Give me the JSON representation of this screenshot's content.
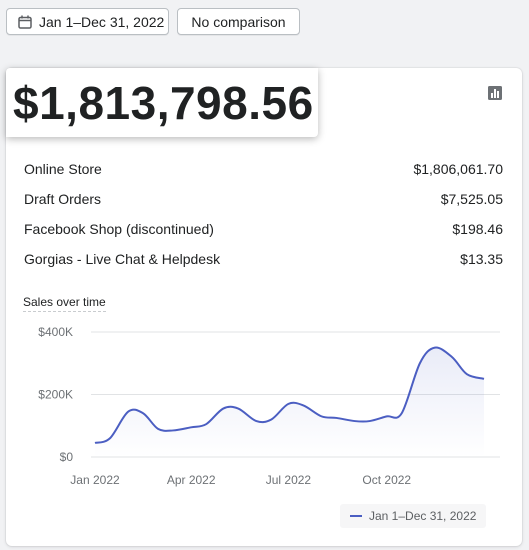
{
  "toolbar": {
    "date_range_label": "Jan 1–Dec 31, 2022",
    "comparison_label": "No comparison"
  },
  "summary": {
    "total_sales": "$1,813,798.56",
    "channels": [
      {
        "name": "Online Store",
        "amount": "$1,806,061.70"
      },
      {
        "name": "Draft Orders",
        "amount": "$7,525.05"
      },
      {
        "name": "Facebook Shop (discontinued)",
        "amount": "$198.46"
      },
      {
        "name": "Gorgias - Live Chat & Helpdesk",
        "amount": "$13.35"
      }
    ]
  },
  "chart_title": "Sales over time",
  "icons": {
    "date": "calendar-icon",
    "chart_toggle": "bar-chart-icon"
  },
  "colors": {
    "series": "#4b5ec2",
    "grid": "#e1e3e5"
  },
  "chart_data": {
    "type": "line",
    "title": "Sales over time",
    "x_tick_labels": [
      "Jan 2022",
      "Apr 2022",
      "Jul 2022",
      "Oct 2022"
    ],
    "y_tick_labels": [
      "$0",
      "$200K",
      "$400K"
    ],
    "ylim": [
      0,
      400000
    ],
    "grid": true,
    "legend_position": "bottom-right",
    "series": [
      {
        "name": "Jan 1–Dec 31, 2022",
        "x": [
          "2022-01-01",
          "2022-01-15",
          "2022-02-01",
          "2022-02-15",
          "2022-03-01",
          "2022-03-15",
          "2022-04-01",
          "2022-04-15",
          "2022-05-01",
          "2022-05-15",
          "2022-06-01",
          "2022-06-15",
          "2022-07-01",
          "2022-07-15",
          "2022-08-01",
          "2022-08-15",
          "2022-09-01",
          "2022-09-15",
          "2022-10-01",
          "2022-10-15",
          "2022-11-01",
          "2022-11-15",
          "2022-12-01",
          "2022-12-15",
          "2022-12-31"
        ],
        "values": [
          45000,
          60000,
          145000,
          140000,
          90000,
          85000,
          95000,
          105000,
          155000,
          155000,
          115000,
          120000,
          170000,
          165000,
          130000,
          125000,
          115000,
          115000,
          130000,
          140000,
          300000,
          350000,
          320000,
          265000,
          250000
        ]
      }
    ]
  }
}
